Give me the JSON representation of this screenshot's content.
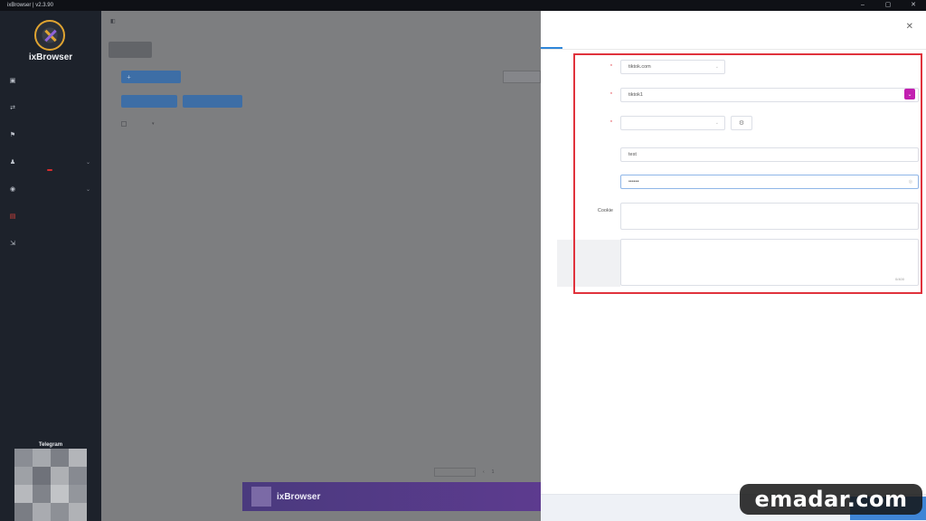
{
  "window": {
    "title": "ixBrowser | v2.3.90"
  },
  "sidebar": {
    "brand": "ixBrowser",
    "items": [
      {
        "label": "",
        "icon": "window-icon"
      },
      {
        "label": "",
        "icon": "proxy-icon"
      },
      {
        "label": "",
        "icon": "group-icon"
      },
      {
        "label": "",
        "icon": "team-icon"
      },
      {
        "label": "",
        "icon": "order-icon"
      },
      {
        "label": "",
        "icon": "recycle-icon"
      },
      {
        "label": "",
        "icon": "import-icon"
      }
    ],
    "new_badge": "",
    "telegram": "Telegram"
  },
  "main": {
    "breadcrumb": [
      "",
      "",
      ""
    ],
    "tab_chip": "",
    "search_placeholder": "",
    "empty_text": "",
    "pager_total": "",
    "pager_size": "",
    "pager_page": "1"
  },
  "banner": {
    "brand_text": "ixBrowser",
    "slogan": ""
  },
  "drawer": {
    "title": "",
    "tabs": [
      "",
      "",
      "",
      ""
    ],
    "fields": {
      "platform": {
        "label": "",
        "value": "tiktok.com"
      },
      "window_name": {
        "label": "",
        "value": "tiktok1"
      },
      "group": {
        "label": "",
        "value": ""
      },
      "username": {
        "label": "",
        "value": "test"
      },
      "password": {
        "label": "",
        "value": "••••••"
      },
      "cookie": {
        "label": "Cookie",
        "placeholder": ""
      },
      "remark": {
        "label": "",
        "placeholder": "",
        "counter": "0/400"
      }
    }
  },
  "watermark": "emadar.com",
  "colors": {
    "accent": "#2f86d9",
    "highlight": "#e0323c",
    "active_menu": "#d9443b",
    "color_swatch": "#c21fb0"
  }
}
